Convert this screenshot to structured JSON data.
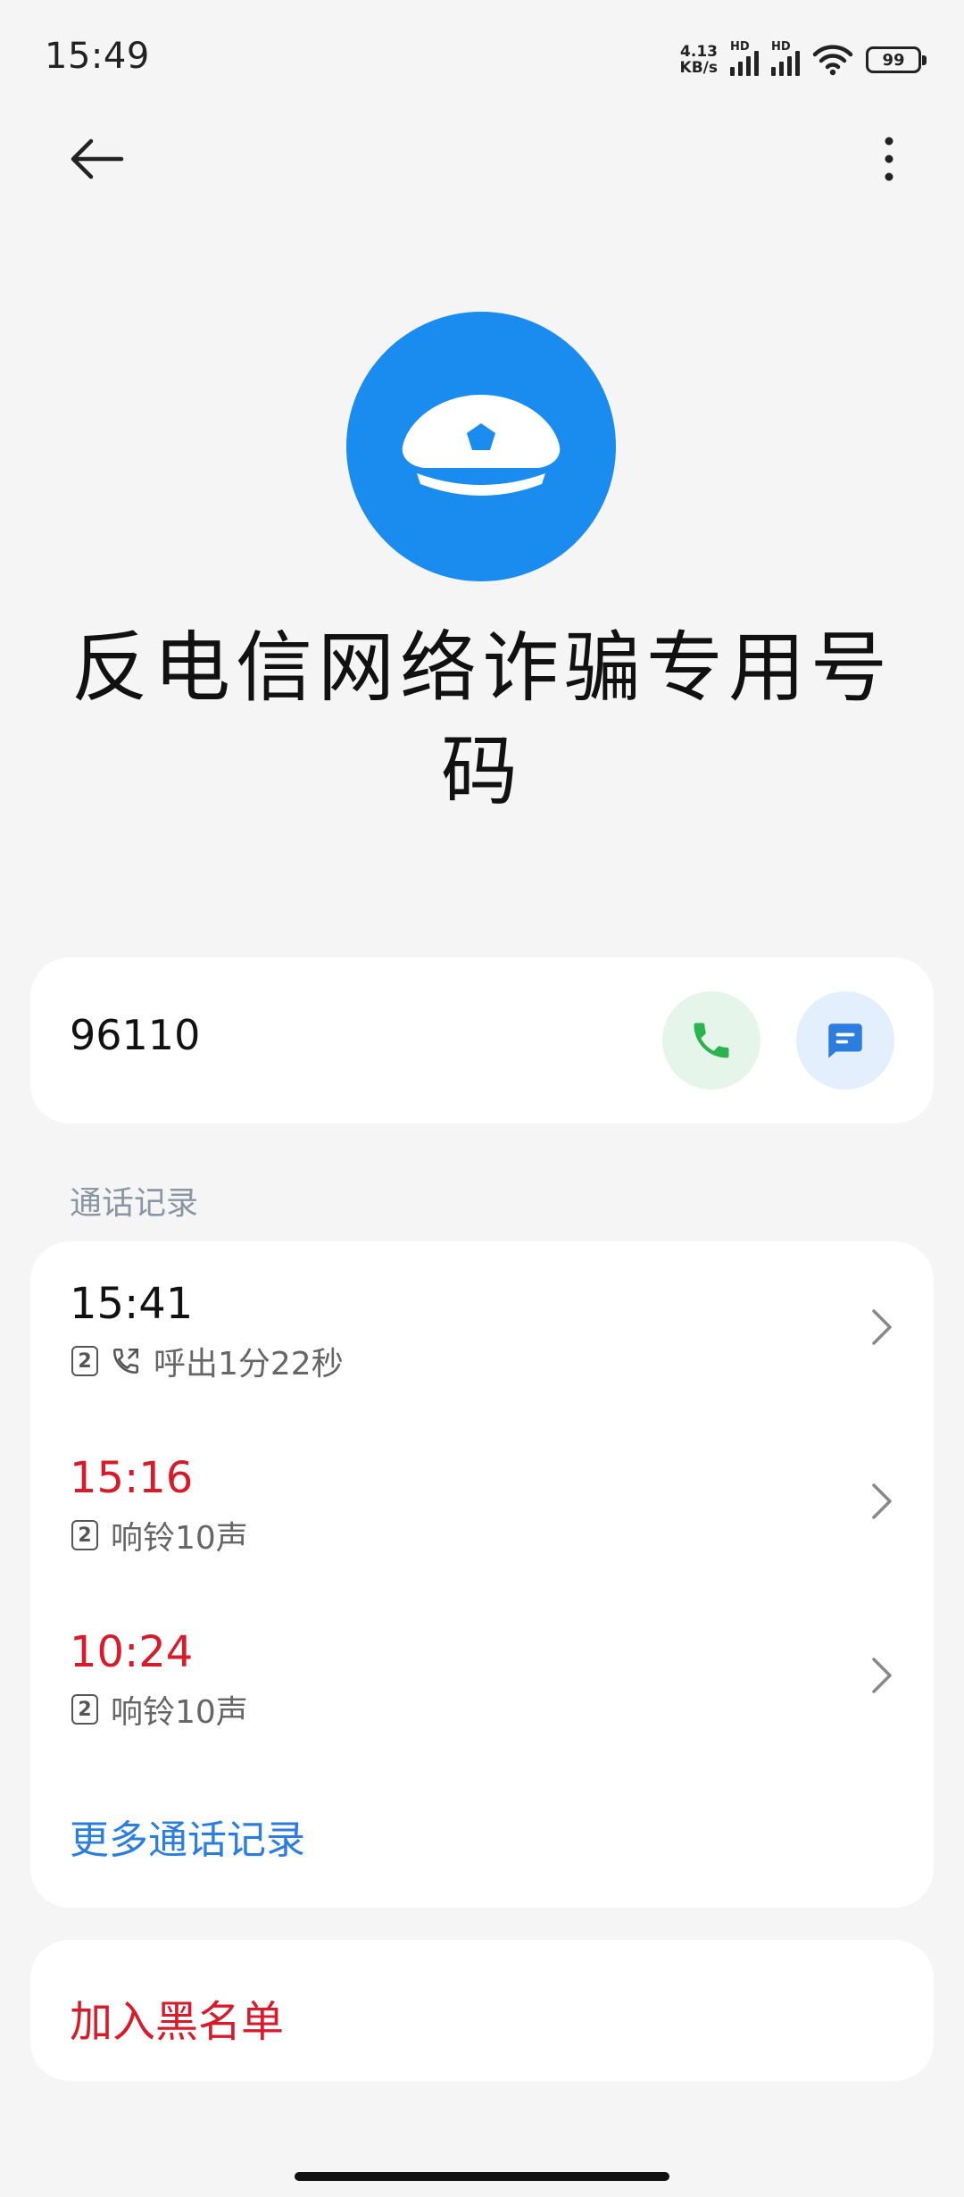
{
  "status_bar": {
    "time": "15:49",
    "net_speed_value": "4.13",
    "net_speed_unit": "KB/s",
    "sim1_label": "HD",
    "sim2_label": "HD",
    "battery": "99"
  },
  "nav": {
    "back_icon": "arrow-left-icon",
    "more_icon": "more-vertical-icon"
  },
  "contact": {
    "avatar_icon": "police-cap-icon",
    "avatar_color": "#1a8cf0",
    "name": "反电信网络诈骗专用号码",
    "number": "96110",
    "call_icon": "phone-icon",
    "message_icon": "message-icon"
  },
  "call_log": {
    "section_label": "通话记录",
    "entries": [
      {
        "time": "15:41",
        "sim": "2",
        "type": "outgoing",
        "detail": "呼出1分22秒"
      },
      {
        "time": "15:16",
        "sim": "2",
        "type": "missed",
        "detail": "响铃10声"
      },
      {
        "time": "10:24",
        "sim": "2",
        "type": "missed",
        "detail": "响铃10声"
      }
    ],
    "more_label": "更多通话记录"
  },
  "actions": {
    "block_label": "加入黑名单"
  },
  "colors": {
    "missed": "#d81b2a",
    "link": "#2b7de0",
    "call_green": "#2bb34f",
    "message_blue": "#2b7de0"
  }
}
